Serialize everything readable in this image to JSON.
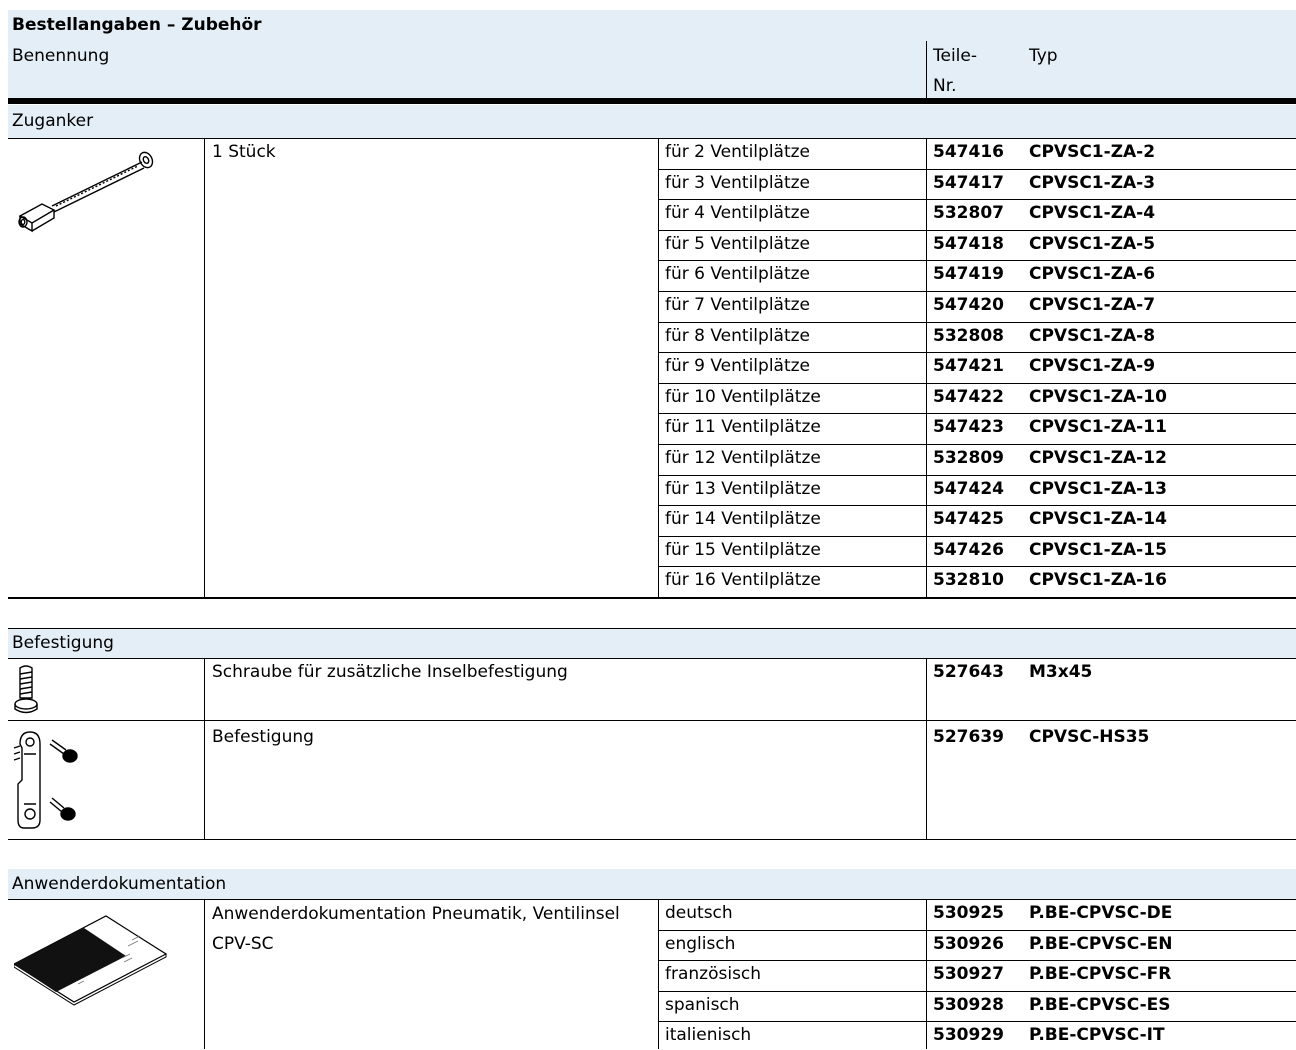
{
  "title": "Bestellangaben – Zubehör",
  "header": {
    "benennung": "Benennung",
    "teile_nr_line1": "Teile-",
    "teile_nr_line2": "Nr.",
    "typ": "Typ"
  },
  "sections": {
    "zuganker": {
      "title": "Zuganker",
      "description": "1 Stück",
      "rows": [
        {
          "option": "für 2 Ventilplätze",
          "part": "547416",
          "type": "CPVSC1-ZA-2"
        },
        {
          "option": "für 3 Ventilplätze",
          "part": "547417",
          "type": "CPVSC1-ZA-3"
        },
        {
          "option": "für 4 Ventilplätze",
          "part": "532807",
          "type": "CPVSC1-ZA-4"
        },
        {
          "option": "für 5 Ventilplätze",
          "part": "547418",
          "type": "CPVSC1-ZA-5"
        },
        {
          "option": "für 6 Ventilplätze",
          "part": "547419",
          "type": "CPVSC1-ZA-6"
        },
        {
          "option": "für 7 Ventilplätze",
          "part": "547420",
          "type": "CPVSC1-ZA-7"
        },
        {
          "option": "für 8 Ventilplätze",
          "part": "532808",
          "type": "CPVSC1-ZA-8"
        },
        {
          "option": "für 9 Ventilplätze",
          "part": "547421",
          "type": "CPVSC1-ZA-9"
        },
        {
          "option": "für 10 Ventilplätze",
          "part": "547422",
          "type": "CPVSC1-ZA-10"
        },
        {
          "option": "für 11 Ventilplätze",
          "part": "547423",
          "type": "CPVSC1-ZA-11"
        },
        {
          "option": "für 12 Ventilplätze",
          "part": "532809",
          "type": "CPVSC1-ZA-12"
        },
        {
          "option": "für 13 Ventilplätze",
          "part": "547424",
          "type": "CPVSC1-ZA-13"
        },
        {
          "option": "für 14 Ventilplätze",
          "part": "547425",
          "type": "CPVSC1-ZA-14"
        },
        {
          "option": "für 15 Ventilplätze",
          "part": "547426",
          "type": "CPVSC1-ZA-15"
        },
        {
          "option": "für 16 Ventilplätze",
          "part": "532810",
          "type": "CPVSC1-ZA-16"
        }
      ]
    },
    "befestigung": {
      "title": "Befestigung",
      "rows": [
        {
          "description": "Schraube für zusätzliche Inselbefestigung",
          "part": "527643",
          "type": "M3x45"
        },
        {
          "description": "Befestigung",
          "part": "527639",
          "type": "CPVSC-HS35"
        }
      ]
    },
    "doku": {
      "title": "Anwenderdokumentation",
      "description_line1": "Anwenderdokumentation Pneumatik, Ventilinsel",
      "description_line2": "CPV-SC",
      "rows": [
        {
          "option": "deutsch",
          "part": "530925",
          "type": "P.BE-CPVSC-DE"
        },
        {
          "option": "englisch",
          "part": "530926",
          "type": "P.BE-CPVSC-EN"
        },
        {
          "option": "französisch",
          "part": "530927",
          "type": "P.BE-CPVSC-FR"
        },
        {
          "option": "spanisch",
          "part": "530928",
          "type": "P.BE-CPVSC-ES"
        },
        {
          "option": "italienisch",
          "part": "530929",
          "type": "P.BE-CPVSC-IT"
        }
      ]
    }
  },
  "icons": [
    "tie-rod-icon",
    "screw-icon",
    "mounting-bracket-icon",
    "manual-booklet-icon"
  ],
  "colors": {
    "header_shade": "#e4eef6",
    "lines": "#000000"
  }
}
